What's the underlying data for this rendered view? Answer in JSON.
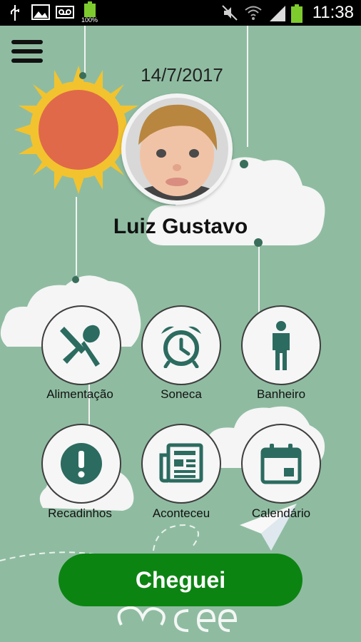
{
  "status_bar": {
    "time": "11:38",
    "battery_text": "100%",
    "icons": [
      "usb-icon",
      "image-icon",
      "voicemail-icon",
      "battery-icon",
      "mute-icon",
      "wifi-icon",
      "signal-icon"
    ]
  },
  "header": {
    "date": "14/7/2017",
    "menu_icon": "hamburger-menu-icon"
  },
  "child": {
    "name": "Luiz Gustavo"
  },
  "actions": [
    {
      "label": "Alimentação",
      "icon": "fork-spoon-icon"
    },
    {
      "label": "Soneca",
      "icon": "alarm-clock-icon"
    },
    {
      "label": "Banheiro",
      "icon": "person-icon"
    },
    {
      "label": "Recadinhos",
      "icon": "exclamation-icon"
    },
    {
      "label": "Aconteceu",
      "icon": "newspaper-icon"
    },
    {
      "label": "Calendário",
      "icon": "calendar-icon"
    }
  ],
  "cta": {
    "label": "Cheguei"
  },
  "colors": {
    "background": "#8fbca1",
    "icon": "#2c6b60",
    "cta": "#0c8412",
    "sun": "#e0694a",
    "sun_rays": "#f2c32e"
  }
}
